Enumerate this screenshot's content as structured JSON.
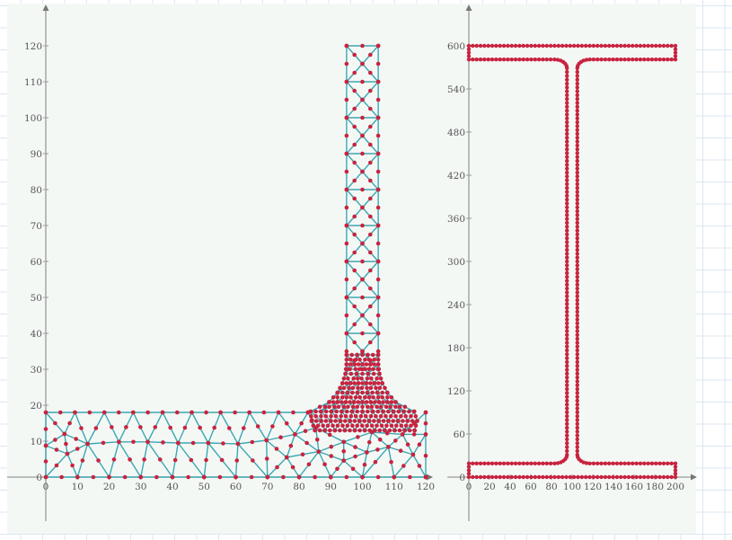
{
  "colors": {
    "mesh_edge": "#3aa8b3",
    "node": "#c8233f",
    "axis": "#9a9a9a",
    "outline": "#c8233f"
  },
  "chart_data": [
    {
      "type": "scatter",
      "title": "",
      "description_kind": "finite-element mesh (quadratic triangles, nodes at vertices and edge midpoints)",
      "xlim": [
        0,
        120
      ],
      "ylim": [
        0,
        120
      ],
      "x_ticks": [
        "0",
        "10",
        "20",
        "30",
        "40",
        "50",
        "60",
        "70",
        "80",
        "90",
        "100",
        "110",
        "120"
      ],
      "y_ticks": [
        "0",
        "10",
        "20",
        "30",
        "40",
        "50",
        "60",
        "70",
        "80",
        "90",
        "100",
        "110",
        "120"
      ],
      "nodes": {
        "T0": [
          0,
          18
        ],
        "T1": [
          9.2,
          18
        ],
        "T2": [
          18.5,
          18
        ],
        "T3": [
          27.6,
          18
        ],
        "T4": [
          36.9,
          18
        ],
        "T5": [
          46.1,
          18
        ],
        "T6": [
          55.2,
          18
        ],
        "T7": [
          64.3,
          18
        ],
        "T8": [
          73.5,
          18
        ],
        "T9": [
          82.8,
          18
        ],
        "TR": [
          120,
          18
        ],
        "B0": [
          0,
          0
        ],
        "B1": [
          10,
          0
        ],
        "B2": [
          20,
          0
        ],
        "B3": [
          30,
          0
        ],
        "B4": [
          40,
          0
        ],
        "B5": [
          50,
          0
        ],
        "B6": [
          60,
          0
        ],
        "B7": [
          70,
          0
        ],
        "B8": [
          80,
          0
        ],
        "B9": [
          90,
          0
        ],
        "B10": [
          100,
          0
        ],
        "B11": [
          110,
          0
        ],
        "B12": [
          120,
          0
        ],
        "M0": [
          0,
          8.75
        ],
        "M1": [
          5.9,
          12
        ],
        "M2": [
          6.8,
          6.5
        ],
        "M3": [
          13.2,
          9.25
        ],
        "M4": [
          23.1,
          9.8
        ],
        "M5": [
          32.2,
          9.8
        ],
        "M6": [
          41.8,
          9.5
        ],
        "M7": [
          51.3,
          9.5
        ],
        "M8": [
          60.7,
          9.25
        ],
        "M9": [
          69.7,
          10.25
        ],
        "M10": [
          78.7,
          11.9
        ],
        "M11": [
          76.1,
          5.5
        ],
        "M12": [
          86.2,
          7.1
        ],
        "M13": [
          85.3,
          13.75
        ],
        "M14": [
          94.1,
          9.8
        ],
        "M15": [
          94.1,
          4.6
        ],
        "M16": [
          101.4,
          6.9
        ],
        "M17": [
          103,
          12.5
        ],
        "M18": [
          108.2,
          8.4
        ],
        "M19": [
          112.7,
          11.9
        ],
        "M20": [
          116,
          6.25
        ],
        "M21": [
          120,
          11.9
        ]
      },
      "triangles": [
        [
          "T0",
          "M0",
          "M1"
        ],
        [
          "T0",
          "M1",
          "T1"
        ],
        [
          "M0",
          "M2",
          "M1"
        ],
        [
          "M1",
          "M2",
          "M3"
        ],
        [
          "M1",
          "M3",
          "T1"
        ],
        [
          "M0",
          "B0",
          "M2"
        ],
        [
          "B0",
          "B1",
          "M2"
        ],
        [
          "M2",
          "B1",
          "M3"
        ],
        [
          "T1",
          "M3",
          "T2"
        ],
        [
          "M3",
          "B1",
          "B2"
        ],
        [
          "M3",
          "M4",
          "T2"
        ],
        [
          "M3",
          "B2",
          "M4"
        ],
        [
          "T2",
          "M4",
          "T3"
        ],
        [
          "M4",
          "B2",
          "B3"
        ],
        [
          "M4",
          "M5",
          "T3"
        ],
        [
          "M4",
          "B3",
          "M5"
        ],
        [
          "T3",
          "M5",
          "T4"
        ],
        [
          "M5",
          "B3",
          "B4"
        ],
        [
          "M5",
          "M6",
          "T4"
        ],
        [
          "M5",
          "B4",
          "M6"
        ],
        [
          "T4",
          "M6",
          "T5"
        ],
        [
          "M6",
          "B4",
          "B5"
        ],
        [
          "M6",
          "M7",
          "T5"
        ],
        [
          "M6",
          "B5",
          "M7"
        ],
        [
          "T5",
          "M7",
          "T6"
        ],
        [
          "M7",
          "B5",
          "B6"
        ],
        [
          "M7",
          "M8",
          "T6"
        ],
        [
          "M7",
          "B6",
          "M8"
        ],
        [
          "T6",
          "M8",
          "T7"
        ],
        [
          "M8",
          "B6",
          "B7"
        ],
        [
          "M8",
          "M9",
          "T7"
        ],
        [
          "M8",
          "B7",
          "M9"
        ],
        [
          "T7",
          "M9",
          "T8"
        ],
        [
          "M9",
          "M10",
          "T8"
        ],
        [
          "M9",
          "B7",
          "M11"
        ],
        [
          "M9",
          "M11",
          "M10"
        ],
        [
          "M11",
          "B7",
          "B8"
        ],
        [
          "M10",
          "M11",
          "M12"
        ],
        [
          "M11",
          "B8",
          "M12"
        ],
        [
          "T8",
          "M10",
          "T9"
        ],
        [
          "M10",
          "M12",
          "M13"
        ],
        [
          "M10",
          "M13",
          "T9"
        ],
        [
          "M12",
          "B8",
          "B9"
        ],
        [
          "M12",
          "B9",
          "M15"
        ],
        [
          "M12",
          "M15",
          "M14"
        ],
        [
          "M12",
          "M14",
          "M13"
        ],
        [
          "M15",
          "B9",
          "B10"
        ],
        [
          "M15",
          "B10",
          "M16"
        ],
        [
          "M14",
          "M15",
          "M16"
        ],
        [
          "M14",
          "M16",
          "M17"
        ],
        [
          "M16",
          "B10",
          "M18"
        ],
        [
          "M16",
          "M18",
          "M17"
        ],
        [
          "M18",
          "B10",
          "B11"
        ],
        [
          "M18",
          "B11",
          "M20"
        ],
        [
          "M18",
          "M20",
          "M19"
        ],
        [
          "M17",
          "M18",
          "M19"
        ],
        [
          "M20",
          "B11",
          "B12"
        ],
        [
          "M20",
          "B12",
          "M21"
        ],
        [
          "M19",
          "M20",
          "M21"
        ],
        [
          "M19",
          "M21",
          "TR"
        ]
      ],
      "vertical_strip": {
        "x_left": 95,
        "x_right": 105,
        "y_from": 30,
        "y_to": 120,
        "cell": 10
      },
      "fillet_region": {
        "web_left": 95,
        "web_right": 105,
        "base_y": 13,
        "top_y": 34,
        "radius": 14,
        "rows": 8
      }
    },
    {
      "type": "line",
      "title": "",
      "description_kind": "I-beam cross-section outline with nodes",
      "xlim": [
        0,
        200
      ],
      "ylim": [
        0,
        600
      ],
      "x_ticks": [
        "0",
        "20",
        "40",
        "60",
        "80",
        "100",
        "120",
        "140",
        "160",
        "180",
        "200"
      ],
      "y_ticks": [
        "0",
        "60",
        "120",
        "180",
        "240",
        "300",
        "360",
        "420",
        "480",
        "540",
        "600"
      ],
      "section": {
        "width": 200,
        "height": 600,
        "flange_thickness": 19,
        "web_left": 95,
        "web_right": 105,
        "root_radius": 12
      }
    }
  ]
}
